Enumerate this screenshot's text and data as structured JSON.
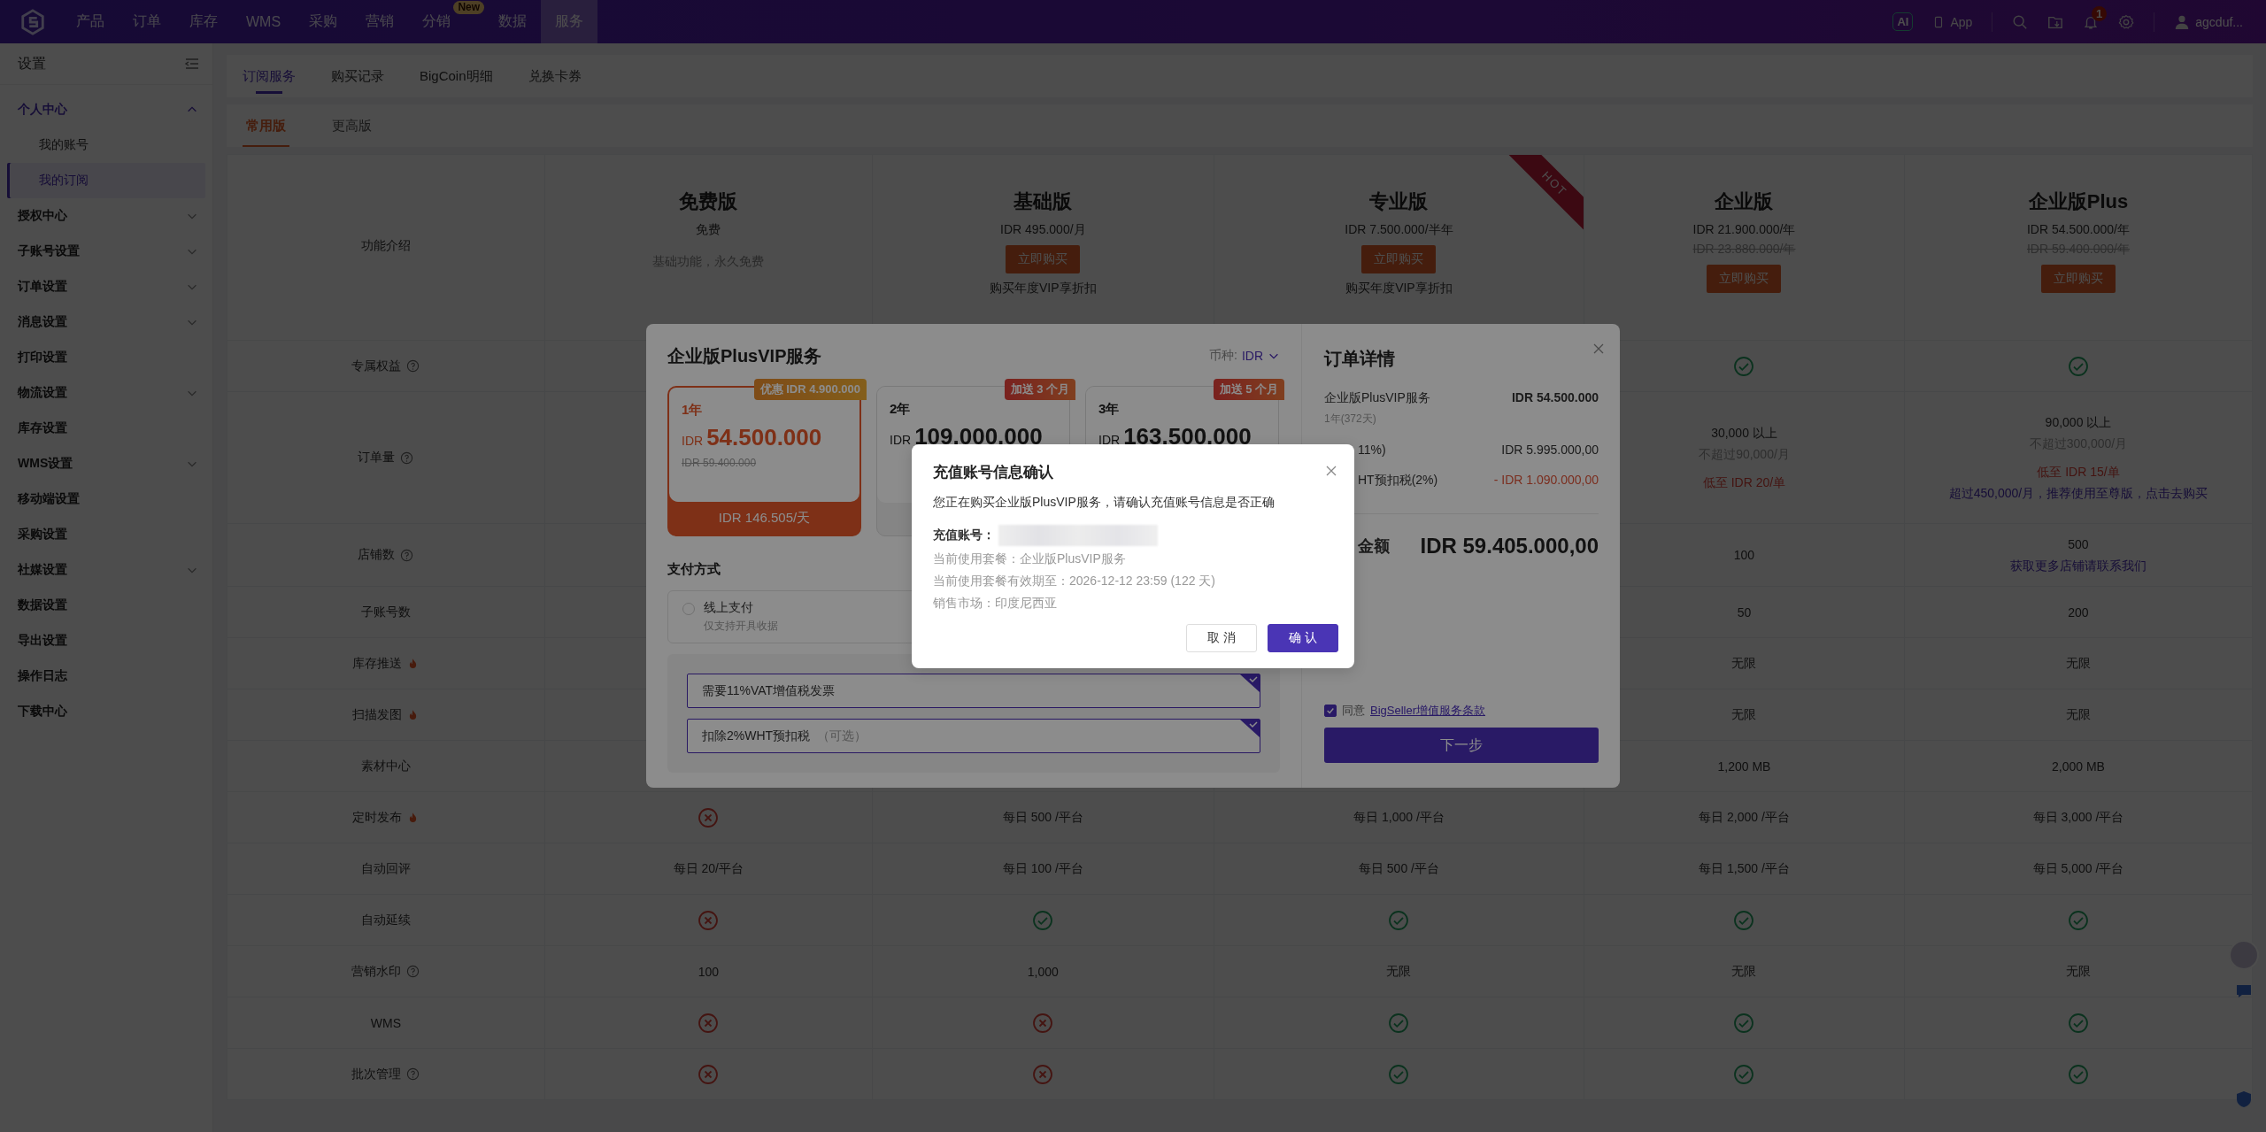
{
  "top_nav": {
    "items": [
      {
        "label": "产品",
        "selected": false
      },
      {
        "label": "订单",
        "selected": false
      },
      {
        "label": "库存",
        "selected": false
      },
      {
        "label": "WMS",
        "selected": false
      },
      {
        "label": "采购",
        "selected": false
      },
      {
        "label": "营销",
        "selected": false
      },
      {
        "label": "分销",
        "selected": false,
        "badge": "New"
      },
      {
        "label": "数据",
        "selected": false
      },
      {
        "label": "服务",
        "selected": true
      }
    ],
    "ai_label": "AI",
    "app_label": "App",
    "notification_count": "1",
    "user_name": "agcduf..."
  },
  "sidebar": {
    "title": "设置",
    "items": [
      {
        "label": "个人中心",
        "expanded": true,
        "children": [
          {
            "label": "我的账号",
            "selected": false
          },
          {
            "label": "我的订阅",
            "selected": true
          }
        ]
      },
      {
        "label": "授权中心",
        "expanded": false
      },
      {
        "label": "子账号设置",
        "expanded": false
      },
      {
        "label": "订单设置",
        "expanded": false
      },
      {
        "label": "消息设置",
        "expanded": false
      },
      {
        "label": "打印设置",
        "selected": false
      },
      {
        "label": "物流设置",
        "expanded": false
      },
      {
        "label": "库存设置",
        "selected": false
      },
      {
        "label": "WMS设置",
        "expanded": false
      },
      {
        "label": "移动端设置",
        "selected": false
      },
      {
        "label": "采购设置",
        "selected": false
      },
      {
        "label": "社媒设置",
        "expanded": false
      },
      {
        "label": "数据设置",
        "selected": false
      },
      {
        "label": "导出设置",
        "selected": false
      },
      {
        "label": "操作日志",
        "selected": false
      },
      {
        "label": "下载中心",
        "selected": false
      }
    ]
  },
  "tabs": [
    {
      "label": "订阅服务",
      "selected": true
    },
    {
      "label": "购买记录",
      "selected": false
    },
    {
      "label": "BigCoin明细",
      "selected": false
    },
    {
      "label": "兑换卡券",
      "selected": false
    }
  ],
  "edition_tabs": [
    {
      "label": "常用版",
      "selected": true
    },
    {
      "label": "更高版",
      "selected": false
    }
  ],
  "plan_table": {
    "header_label": "功能介绍",
    "plans": [
      {
        "name": "免费版",
        "price": "免费",
        "description": "基础功能，永久免费"
      },
      {
        "name": "基础版",
        "price": "IDR 495.000/月",
        "button": "立即购买",
        "note": "购买年度VIP享折扣"
      },
      {
        "name": "专业版",
        "price": "IDR 7.500.000/半年",
        "button": "立即购买",
        "note": "购买年度VIP享折扣",
        "ribbon": "HOT"
      },
      {
        "name": "企业版",
        "price": "IDR 21.900.000/年",
        "old_price": "IDR 23.880.000/年",
        "button": "立即购买"
      },
      {
        "name": "企业版Plus",
        "price": "IDR 54.500.000/年",
        "old_price": "IDR 59.400.000/年",
        "button": "立即购买"
      }
    ],
    "rows": [
      {
        "label": "专属权益",
        "kind": "help",
        "cells": [
          {
            "kind": "check"
          },
          {
            "kind": "check"
          }
        ]
      },
      {
        "label": "订单量",
        "kind": "help",
        "cells": [
          {
            "kind": "lines",
            "lines": [
              {
                "text": "30,000 以上",
                "kind": "main"
              },
              {
                "text": "不超过90,000/月",
                "kind": "muted"
              },
              {
                "text": "低至 IDR 20/单",
                "kind": "accent"
              }
            ]
          },
          {
            "kind": "lines",
            "lines": [
              {
                "text": "90,000 以上",
                "kind": "main"
              },
              {
                "text": "不超过300,000/月",
                "kind": "muted"
              },
              {
                "text": "低至 IDR 15/单",
                "kind": "accent"
              },
              {
                "text": "超过450,000/月，推荐使用至尊版，点击去购买",
                "kind": "link"
              }
            ]
          }
        ]
      },
      {
        "label": "店铺数",
        "kind": "help",
        "cells": [
          {
            "kind": "text",
            "text": "100"
          },
          {
            "kind": "lines",
            "lines": [
              {
                "text": "500",
                "kind": "main"
              },
              {
                "text": "获取更多店铺请联系我们",
                "kind": "link"
              }
            ]
          }
        ]
      },
      {
        "label": "子账号数",
        "kind": "plain",
        "cells": [
          {
            "kind": "text",
            "text": "50"
          },
          {
            "kind": "text",
            "text": "200"
          }
        ]
      },
      {
        "label": "库存推送",
        "kind": "hot",
        "cells": [
          {
            "kind": "text",
            "text": "无限"
          },
          {
            "kind": "text",
            "text": "无限"
          }
        ]
      },
      {
        "label": "扫描发图",
        "kind": "hot",
        "cells": [
          {
            "kind": "text",
            "text": "无限"
          },
          {
            "kind": "text",
            "text": "无限"
          }
        ]
      },
      {
        "label": "素材中心",
        "kind": "plain",
        "cells": [
          {
            "kind": "text",
            "text": "1,200 MB"
          },
          {
            "kind": "text",
            "text": "2,000 MB"
          }
        ]
      },
      {
        "label": "定时发布",
        "kind": "hot",
        "cells": [
          {
            "kind": "cross"
          },
          {
            "kind": "text",
            "text": "每日 500 /平台"
          },
          {
            "kind": "text",
            "text": "每日 1,000 /平台"
          },
          {
            "kind": "text",
            "text": "每日 2,000 /平台"
          },
          {
            "kind": "text",
            "text": "每日 3,000 /平台"
          }
        ]
      },
      {
        "label": "自动回评",
        "kind": "plain",
        "cells": [
          {
            "kind": "text",
            "text": "每日 20/平台"
          },
          {
            "kind": "text",
            "text": "每日 100 /平台"
          },
          {
            "kind": "text",
            "text": "每日 500 /平台"
          },
          {
            "kind": "text",
            "text": "每日 1,500 /平台"
          },
          {
            "kind": "text",
            "text": "每日 5,000 /平台"
          }
        ]
      },
      {
        "label": "自动延续",
        "kind": "plain",
        "cells": [
          {
            "kind": "cross"
          },
          {
            "kind": "check"
          },
          {
            "kind": "check"
          },
          {
            "kind": "check"
          },
          {
            "kind": "check"
          }
        ]
      },
      {
        "label": "营销水印",
        "kind": "help",
        "cells": [
          {
            "kind": "text",
            "text": "100"
          },
          {
            "kind": "text",
            "text": "1,000"
          },
          {
            "kind": "text",
            "text": "无限"
          },
          {
            "kind": "text",
            "text": "无限"
          },
          {
            "kind": "text",
            "text": "无限"
          }
        ]
      },
      {
        "label": "WMS",
        "kind": "plain",
        "cells": [
          {
            "kind": "cross"
          },
          {
            "kind": "cross"
          },
          {
            "kind": "check"
          },
          {
            "kind": "check"
          },
          {
            "kind": "check"
          }
        ]
      },
      {
        "label": "批次管理",
        "kind": "help",
        "cells": [
          {
            "kind": "cross"
          },
          {
            "kind": "cross"
          },
          {
            "kind": "check"
          },
          {
            "kind": "check"
          },
          {
            "kind": "check"
          }
        ]
      }
    ]
  },
  "plan_modal": {
    "title": "企业版PlusVIP服务",
    "currency_label": "币种:",
    "currency": "IDR",
    "options": [
      {
        "term": "1年",
        "currency": "IDR",
        "amount": "54.500.000",
        "old_price": "IDR 59.400.000",
        "daily": "IDR 146.505/天",
        "tag": {
          "text": "优惠 IDR 4.900.000",
          "kind": "discount"
        },
        "selected": true
      },
      {
        "term": "2年",
        "currency": "IDR",
        "amount": "109.000.000",
        "tag": {
          "text": "加送 3 个月",
          "kind": "bonus"
        },
        "selected": false
      },
      {
        "term": "3年",
        "currency": "IDR",
        "amount": "163.500.000",
        "tag": {
          "text": "加送 5 个月",
          "kind": "bonus"
        },
        "selected": false
      }
    ],
    "payment_title": "支付方式",
    "payment_methods": [
      {
        "label": "线上支付",
        "sub": "仅支持开具收据",
        "selected": false
      }
    ],
    "extras": [
      {
        "label": "需要11%VAT增值税发票",
        "checked": true
      },
      {
        "label": "扣除2%WHT预扣税",
        "hint": "（可选）",
        "checked": true
      }
    ]
  },
  "order": {
    "title": "订单详情",
    "lines": [
      {
        "kind": "item",
        "label": "企业版PlusVIP服务",
        "sub": "1年(372天)",
        "amount": "IDR 54.500.000"
      },
      {
        "kind": "fee",
        "label": "11%)",
        "amount": "IDR 5.995.000,00"
      },
      {
        "kind": "deduction",
        "label": "HT预扣税(2%)",
        "amount": "- IDR 1.090.000,00"
      }
    ],
    "total_label": "金额",
    "total": "IDR 59.405.000,00",
    "agree_checked": true,
    "agree_label": "同意",
    "terms_link": "BigSeller增值服务条款",
    "next_button": "下一步"
  },
  "confirm_dialog": {
    "title": "充值账号信息确认",
    "message": "您正在购买企业版PlusVIP服务，请确认充值账号信息是否正确",
    "account_label": "充值账号：",
    "details": [
      "当前使用套餐：企业版PlusVIP服务",
      "当前使用套餐有效期至：2026-12-12 23:59 (122 天)",
      "销售市场：印度尼西亚"
    ],
    "buttons": [
      {
        "label": "取 消",
        "kind": "secondary"
      },
      {
        "label": "确 认",
        "kind": "primary"
      }
    ]
  }
}
